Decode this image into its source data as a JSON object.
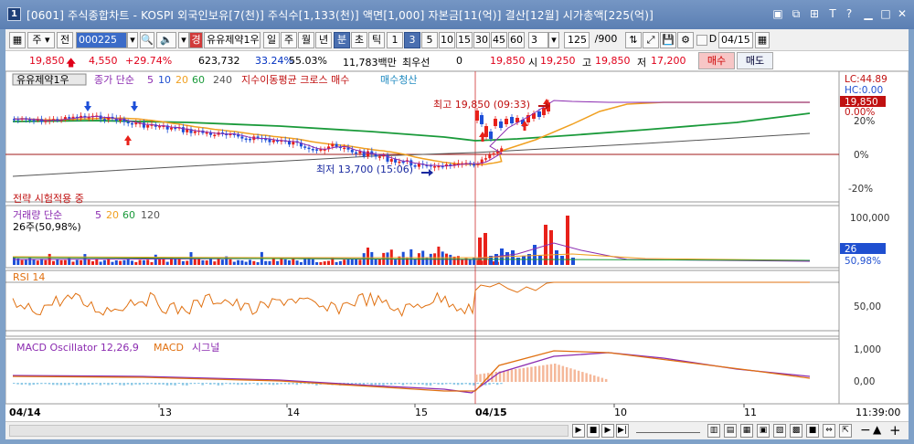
{
  "title": {
    "text": "[0601] 주식종합차트 - KOSPI 외국인보유[7(천)] 주식수[1,133(천)] 액면[1,000] 자본금[11(억)] 결산[12월] 시가총액[225(억)]",
    "window_number": "1"
  },
  "toolbar": {
    "main_label": "주",
    "prev_label": "전",
    "code": "000225",
    "stock_name": "유유제약1우",
    "period_day": "일",
    "period_week": "주",
    "period_month": "월",
    "period_year": "년",
    "period_minute": "분",
    "period_second": "초",
    "period_tick": "틱",
    "intervals": [
      "1",
      "3",
      "5",
      "10",
      "15",
      "30",
      "45",
      "60"
    ],
    "interval_value": "3",
    "count": "125",
    "total": "/900",
    "date": "04/15",
    "check_d": "D",
    "warning_badge": "경"
  },
  "price": {
    "current": "19,850",
    "change": "4,550",
    "change_pct": "+29.74%",
    "volume": "623,732",
    "vol_pct1": "33.24%",
    "vol_pct2": "55.03%",
    "amount": "11,783백만",
    "stock_type": "최우선",
    "stock_type_value": "0",
    "last": "19,850",
    "open_label": "시",
    "open": "19,250",
    "high_label": "고",
    "high": "19,850",
    "low_label": "저",
    "low": "17,200",
    "buy_label": "매수",
    "sell_label": "매도"
  },
  "chart": {
    "pane1": {
      "stock_label": "유유제약1우",
      "ma_title": "종가 단순",
      "ma_periods": [
        "5",
        "10",
        "20",
        "60",
        "240"
      ],
      "strategy_text": "지수이동평균 크로스 매수",
      "strategy_exit": "매수청산",
      "lc_label": "LC:44.89",
      "hc_label": "HC:0.00",
      "current_price_tag": "19,850",
      "pct_tag": "0.00%",
      "axis": [
        "20%",
        "0%",
        "-20%"
      ],
      "high_annotation": "최고 19,850 (09:33)",
      "low_annotation": "최저 13,700 (15:06)",
      "strategy_testing": "전략 시험적용 중"
    },
    "pane2": {
      "title": "거래량 단순",
      "ma_periods": [
        "5",
        "20",
        "60",
        "120"
      ],
      "summary": "26주(50,98%)",
      "axis_top": "100,000",
      "tag_value": "26",
      "tag_pct": "50,98%"
    },
    "pane3": {
      "title": "RSI 14",
      "axis_mid": "50,00"
    },
    "pane4": {
      "title": "MACD Oscillator 12,26,9",
      "macd_label": "MACD",
      "signal_label": "시그널",
      "axis_top": "1,000",
      "axis_mid": "0,00"
    },
    "xaxis": {
      "labels": [
        "04/14",
        "13",
        "14",
        "15",
        "04/15",
        "10",
        "11"
      ],
      "time": "11:39:00"
    },
    "colors": {
      "up": "#e8211a",
      "down": "#1d4fd8",
      "ma5": "#8b2bb0",
      "ma10": "#1f4fd0",
      "ma20": "#f0a020",
      "ma60": "#1a9a3a",
      "ma240": "#555555"
    }
  }
}
